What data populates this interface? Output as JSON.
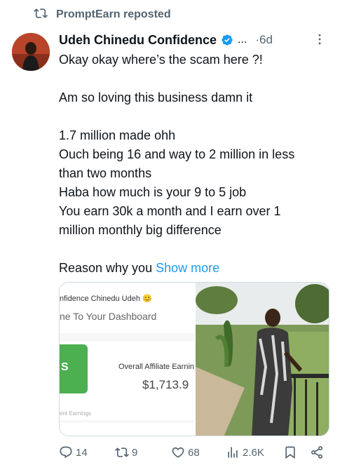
{
  "repost": {
    "label": "PromptEarn reposted",
    "icon": "repost-icon"
  },
  "tweet": {
    "author": "Udeh Chinedu Confidence",
    "verified": true,
    "name_overflow": "...",
    "time": "·6d",
    "lines": [
      "Okay okay where’s the scam here ?!",
      "",
      "Am so loving this business damn it",
      "",
      "1.7 million made ohh",
      "Ouch being 16 and way to 2 million in less",
      "than two months",
      "Haba how much is your 9 to 5 job",
      "You earn 30k a month and I earn over 1",
      "million monthly big difference",
      "",
      "Reason why you "
    ],
    "show_more": "Show more"
  },
  "media": {
    "screenshot": {
      "name_line": "nfidence Chinedu Udeh 😊",
      "welcome": "ne To Your Dashboard",
      "card_letter": "S",
      "label": "Overall Affiliate Earnin",
      "amount": "$1,713.9",
      "footer": "ent Earnings"
    },
    "photo": {
      "description_icon": "photo-image"
    }
  },
  "actions": {
    "replies": "14",
    "reposts": "9",
    "likes": "68",
    "views": "2.6K"
  },
  "colors": {
    "text": "#0f1419",
    "secondary": "#536471",
    "link": "#1d9bf0",
    "verified": "#1d9bf0",
    "accent_green": "#4caf50"
  }
}
